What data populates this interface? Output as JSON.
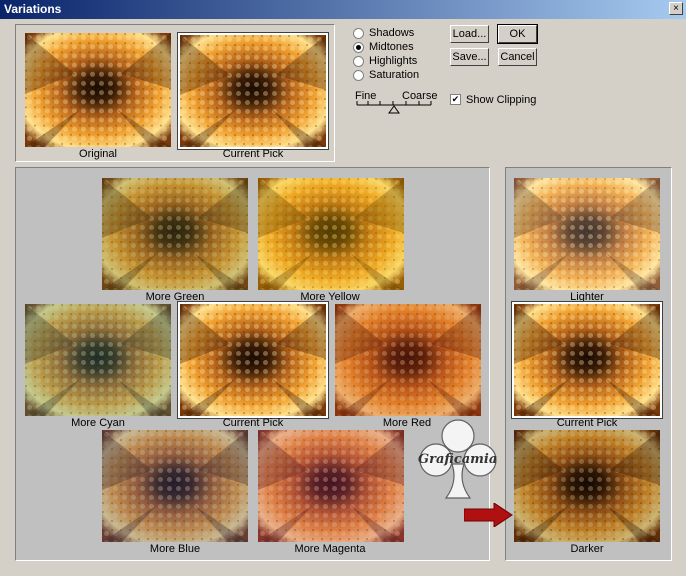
{
  "window": {
    "title": "Variations",
    "close_glyph": "×"
  },
  "top_previews": [
    {
      "caption": "Original",
      "selected": false
    },
    {
      "caption": "Current Pick",
      "selected": true
    }
  ],
  "tone": {
    "options": [
      "Shadows",
      "Midtones",
      "Highlights",
      "Saturation"
    ],
    "selected": "Midtones"
  },
  "slider": {
    "fine_label": "Fine",
    "coarse_label": "Coarse",
    "level_fraction": 0.5
  },
  "buttons": {
    "load": "Load...",
    "save": "Save...",
    "ok": "OK",
    "cancel": "Cancel"
  },
  "show_clipping": {
    "label": "Show Clipping",
    "checked": true
  },
  "color_grid": [
    {
      "caption": "More Green",
      "tint": "#556b2f",
      "selected": false
    },
    {
      "caption": "More Yellow",
      "tint": "#e8c000",
      "selected": false
    },
    {
      "caption": "More Cyan",
      "tint": "#2e8b8b",
      "selected": false
    },
    {
      "caption": "Current Pick",
      "tint": "",
      "selected": true
    },
    {
      "caption": "More Red",
      "tint": "#c0301a",
      "selected": false
    },
    {
      "caption": "More Blue",
      "tint": "#3a4a9a",
      "selected": false
    },
    {
      "caption": "More Magenta",
      "tint": "#b0307a",
      "selected": false
    }
  ],
  "brightness": [
    {
      "caption": "Lighter",
      "selected": false
    },
    {
      "caption": "Current Pick",
      "selected": true
    },
    {
      "caption": "Darker",
      "selected": false
    }
  ],
  "watermark": {
    "text": "Graficamia",
    "icon": "club-icon"
  },
  "arrow": {
    "icon": "red-arrow-icon",
    "color": "#b01010"
  },
  "colors": {
    "title_start": "#0a246a",
    "title_end": "#a6caf0",
    "face": "#d4d0c8"
  }
}
